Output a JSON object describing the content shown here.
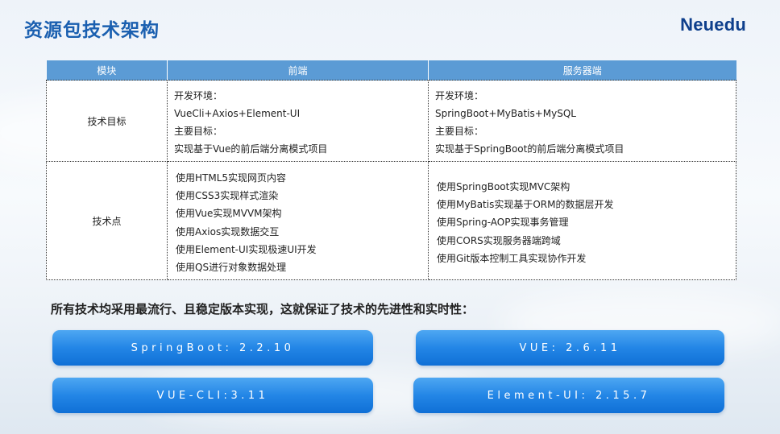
{
  "title": "资源包技术架构",
  "brand": "Neuedu",
  "table": {
    "headers": [
      "模块",
      "前端",
      "服务器端"
    ],
    "rows": [
      {
        "label": "技术目标",
        "frontend": [
          "开发环境：",
          "VueCli+Axios+Element-UI",
          "主要目标：",
          "实现基于Vue的前后端分离模式项目"
        ],
        "server": [
          "开发环境：",
          "SpringBoot+MyBatis+MySQL",
          "主要目标：",
          "实现基于SpringBoot的前后端分离模式项目"
        ]
      },
      {
        "label": "技术点",
        "frontend": [
          "使用HTML5实现网页内容",
          "使用CSS3实现样式渲染",
          "使用Vue实现MVVM架构",
          "使用Axios实现数据交互",
          "使用Element-UI实现极速UI开发",
          "使用QS进行对象数据处理"
        ],
        "server": [
          "使用SpringBoot实现MVC架构",
          "使用MyBatis实现基于ORM的数据层开发",
          "使用Spring-AOP实现事务管理",
          "使用CORS实现服务器端跨域",
          "使用Git版本控制工具实现协作开发"
        ]
      }
    ]
  },
  "summary": "所有技术均采用最流行、且稳定版本实现，这就保证了技术的先进性和实时性：",
  "versions": [
    "SpringBoot: 2.2.10",
    "VUE: 2.6.11",
    "VUE-CLI:3.11",
    "Element-UI: 2.15.7"
  ],
  "colors": {
    "title": "#1a5fb0",
    "brand": "#0e3f8c",
    "header_bg": "#5b9bd5",
    "pill": "#2386e6"
  }
}
